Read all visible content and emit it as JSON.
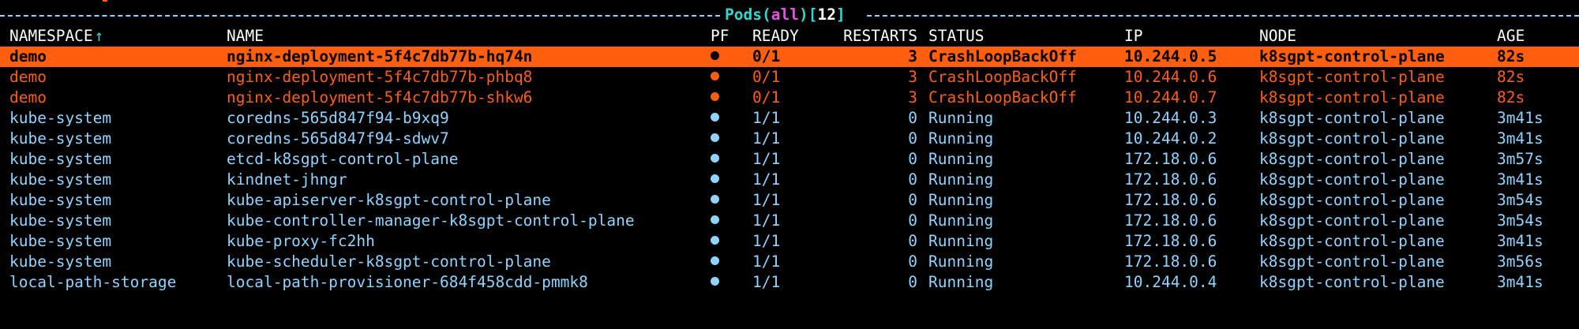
{
  "view": {
    "name": "Pods",
    "scope": "all",
    "count": "12"
  },
  "columns": {
    "namespace": "NAMESPACE",
    "name": "NAME",
    "pf": "PF",
    "ready": "READY",
    "restarts": "RESTARTS",
    "status": "STATUS",
    "ip": "IP",
    "node": "NODE",
    "age": "AGE",
    "sort_indicator": "↑"
  },
  "colors": {
    "background": "#000000",
    "error": "#ff5f0e",
    "normal": "#8fd4ff",
    "header": "#ffffff",
    "title": "#34d7d0",
    "scope": "#e056e0"
  },
  "pf_icon": "●",
  "pods": [
    {
      "namespace": "demo",
      "name": "nginx-deployment-5f4c7db77b-hq74n",
      "ready": "0/1",
      "restarts": "3",
      "status": "CrashLoopBackOff",
      "ip": "10.244.0.5",
      "node": "k8sgpt-control-plane",
      "age": "82s",
      "state": "selected"
    },
    {
      "namespace": "demo",
      "name": "nginx-deployment-5f4c7db77b-phbq8",
      "ready": "0/1",
      "restarts": "3",
      "status": "CrashLoopBackOff",
      "ip": "10.244.0.6",
      "node": "k8sgpt-control-plane",
      "age": "82s",
      "state": "error"
    },
    {
      "namespace": "demo",
      "name": "nginx-deployment-5f4c7db77b-shkw6",
      "ready": "0/1",
      "restarts": "3",
      "status": "CrashLoopBackOff",
      "ip": "10.244.0.7",
      "node": "k8sgpt-control-plane",
      "age": "82s",
      "state": "error"
    },
    {
      "namespace": "kube-system",
      "name": "coredns-565d847f94-b9xq9",
      "ready": "1/1",
      "restarts": "0",
      "status": "Running",
      "ip": "10.244.0.3",
      "node": "k8sgpt-control-plane",
      "age": "3m41s",
      "state": "normal"
    },
    {
      "namespace": "kube-system",
      "name": "coredns-565d847f94-sdwv7",
      "ready": "1/1",
      "restarts": "0",
      "status": "Running",
      "ip": "10.244.0.2",
      "node": "k8sgpt-control-plane",
      "age": "3m41s",
      "state": "normal"
    },
    {
      "namespace": "kube-system",
      "name": "etcd-k8sgpt-control-plane",
      "ready": "1/1",
      "restarts": "0",
      "status": "Running",
      "ip": "172.18.0.6",
      "node": "k8sgpt-control-plane",
      "age": "3m57s",
      "state": "normal"
    },
    {
      "namespace": "kube-system",
      "name": "kindnet-jhngr",
      "ready": "1/1",
      "restarts": "0",
      "status": "Running",
      "ip": "172.18.0.6",
      "node": "k8sgpt-control-plane",
      "age": "3m41s",
      "state": "normal"
    },
    {
      "namespace": "kube-system",
      "name": "kube-apiserver-k8sgpt-control-plane",
      "ready": "1/1",
      "restarts": "0",
      "status": "Running",
      "ip": "172.18.0.6",
      "node": "k8sgpt-control-plane",
      "age": "3m54s",
      "state": "normal"
    },
    {
      "namespace": "kube-system",
      "name": "kube-controller-manager-k8sgpt-control-plane",
      "ready": "1/1",
      "restarts": "0",
      "status": "Running",
      "ip": "172.18.0.6",
      "node": "k8sgpt-control-plane",
      "age": "3m54s",
      "state": "normal"
    },
    {
      "namespace": "kube-system",
      "name": "kube-proxy-fc2hh",
      "ready": "1/1",
      "restarts": "0",
      "status": "Running",
      "ip": "172.18.0.6",
      "node": "k8sgpt-control-plane",
      "age": "3m41s",
      "state": "normal"
    },
    {
      "namespace": "kube-system",
      "name": "kube-scheduler-k8sgpt-control-plane",
      "ready": "1/1",
      "restarts": "0",
      "status": "Running",
      "ip": "172.18.0.6",
      "node": "k8sgpt-control-plane",
      "age": "3m56s",
      "state": "normal"
    },
    {
      "namespace": "local-path-storage",
      "name": "local-path-provisioner-684f458cdd-pmmk8",
      "ready": "1/1",
      "restarts": "0",
      "status": "Running",
      "ip": "10.244.0.4",
      "node": "k8sgpt-control-plane",
      "age": "3m41s",
      "state": "normal"
    }
  ]
}
